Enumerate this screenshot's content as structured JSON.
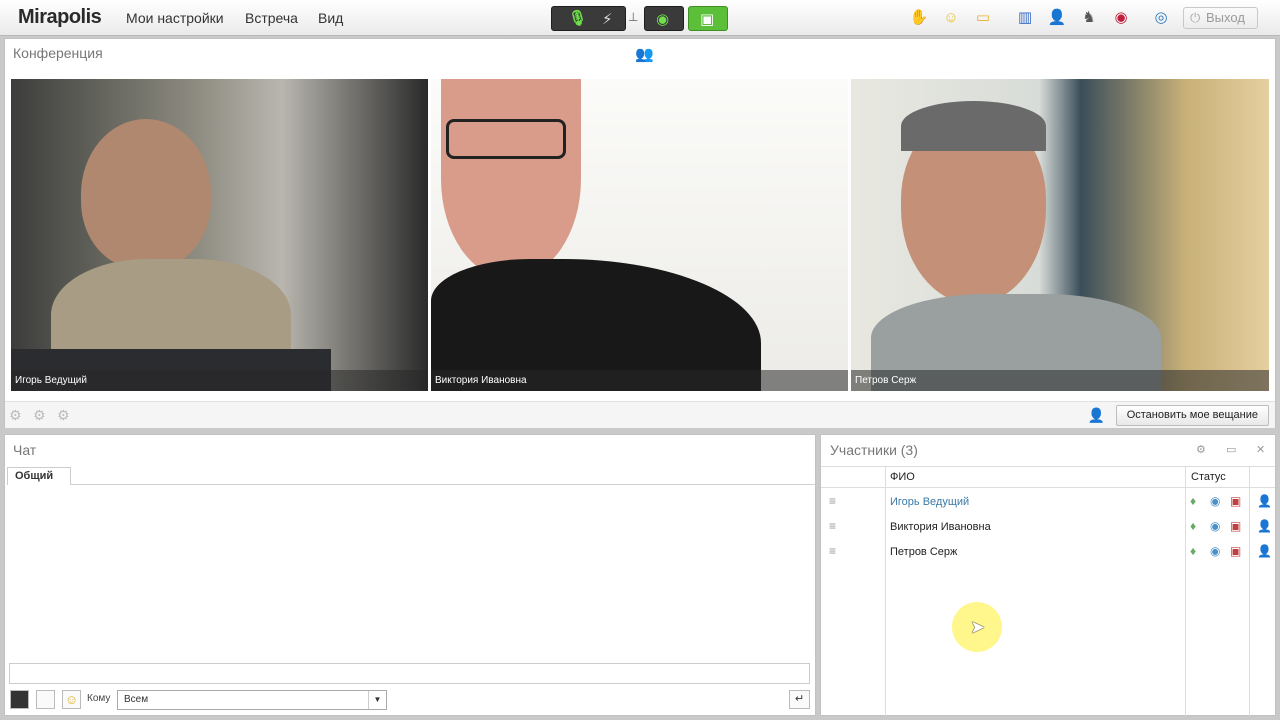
{
  "app": {
    "logo": "Mirapolis"
  },
  "menu": [
    {
      "label": "Мои настройки"
    },
    {
      "label": "Встреча"
    },
    {
      "label": "Вид"
    }
  ],
  "topbar": {
    "logout_label": "Выход"
  },
  "conference": {
    "title": "Конференция",
    "videos": [
      {
        "name": "Игорь Ведущий"
      },
      {
        "name": "Виктория Ивановна"
      },
      {
        "name": "Петров Серж"
      }
    ],
    "stop_button": "Остановить мое вещание"
  },
  "chat": {
    "title": "Чат",
    "tab": "Общий",
    "to_label": "Кому",
    "to_value": "Всем"
  },
  "participants": {
    "title": "Участники (3)",
    "col_name": "ФИО",
    "col_status": "Статус",
    "rows": [
      {
        "name": "Игорь Ведущий",
        "host": true
      },
      {
        "name": "Виктория Ивановна",
        "host": false
      },
      {
        "name": "Петров Серж",
        "host": false
      }
    ]
  },
  "colors": {
    "accent_green": "#5bbf3a",
    "host_name": "#3a7aa8"
  }
}
